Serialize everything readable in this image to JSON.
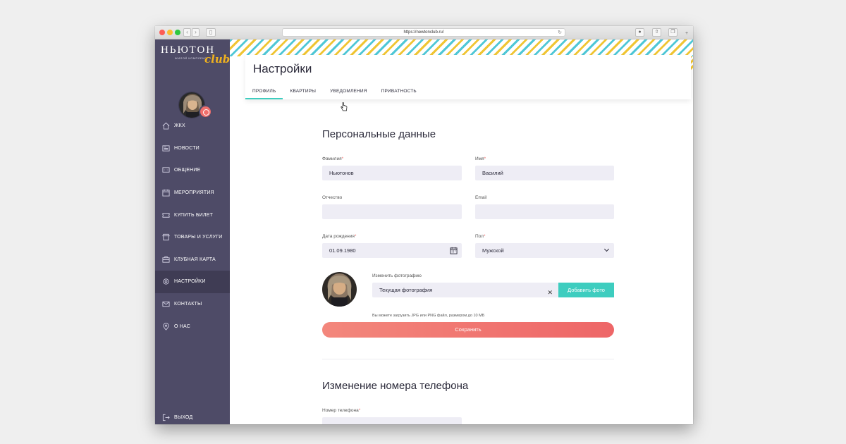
{
  "browser": {
    "url": "https://newtonclub.ru/"
  },
  "brand": {
    "name": "НЬЮТОН",
    "tagline": "ЖИЛОЙ КОМПЛЕКС",
    "sub": "club",
    "accent": "#f0b21e"
  },
  "sidebar": {
    "items": [
      {
        "label": "ЖКХ",
        "icon": "house-icon"
      },
      {
        "label": "НОВОСТИ",
        "icon": "newspaper-icon"
      },
      {
        "label": "ОБЩЕНИЕ",
        "icon": "chat-icon"
      },
      {
        "label": "МЕРОПРИЯТИЯ",
        "icon": "calendar-icon"
      },
      {
        "label": "КУПИТЬ БИЛЕТ",
        "icon": "ticket-icon"
      },
      {
        "label": "ТОВАРЫ И УСЛУГИ",
        "icon": "shop-icon"
      },
      {
        "label": "КЛУБНАЯ КАРТА",
        "icon": "card-icon"
      },
      {
        "label": "НАСТРОЙКИ",
        "icon": "gear-icon",
        "active": true
      },
      {
        "label": "КОНТАКТЫ",
        "icon": "mail-icon"
      },
      {
        "label": "О НАС",
        "icon": "location-icon"
      }
    ],
    "logout_label": "ВЫХОД"
  },
  "header": {
    "title": "Настройки",
    "tabs": [
      {
        "label": "ПРОФИЛЬ",
        "active": true
      },
      {
        "label": "КВАРТИРЫ"
      },
      {
        "label": "УВЕДОМЛЕНИЯ"
      },
      {
        "label": "ПРИВАТНОСТЬ"
      }
    ]
  },
  "personal": {
    "title": "Персональные данные",
    "surname": {
      "label": "Фамилия",
      "value": "Ньютонов"
    },
    "name": {
      "label": "Имя",
      "value": "Василий"
    },
    "patronymic": {
      "label": "Отчество",
      "value": ""
    },
    "email": {
      "label": "Email",
      "value": ""
    },
    "birthdate": {
      "label": "Дата рождения",
      "value": "01.09.1980"
    },
    "gender": {
      "label": "Пол",
      "value": "Мужской"
    },
    "photo": {
      "label": "Изменить фотографию",
      "current": "Текущая фотография",
      "add_button": "Добавить фото",
      "hint": "Вы можете загрузить JPG или PNG файл, размером до 10 МБ"
    },
    "save_button": "Сохранить"
  },
  "phone": {
    "title": "Изменение номера телефона",
    "label": "Номер телефона",
    "value": ""
  },
  "required_mark": "*",
  "colors": {
    "sidebar": "#4e4b67",
    "accent_teal": "#3ecdbf",
    "accent_coral": "#ef6f6c",
    "input_bg": "#eeedf5"
  }
}
